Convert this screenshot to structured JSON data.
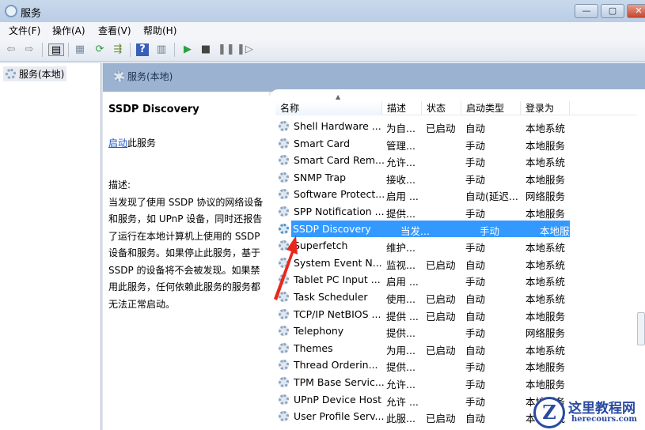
{
  "window": {
    "title": "服务",
    "minimize": "—",
    "maximize": "▢",
    "close": "✕"
  },
  "menu": [
    "文件(F)",
    "操作(A)",
    "查看(V)",
    "帮助(H)"
  ],
  "toolbar": {
    "icons": [
      "back-icon",
      "forward-icon",
      "console-tree-icon",
      "properties-icon",
      "refresh-icon",
      "export-icon",
      "help-icon",
      "view-icon",
      "start-icon",
      "stop-icon",
      "pause-icon",
      "resume-icon"
    ]
  },
  "tree": {
    "root": "服务(本地)"
  },
  "pane": {
    "title": "服务(本地)"
  },
  "detail": {
    "service_name": "SSDP Discovery",
    "start_link": "启动",
    "start_suffix": "此服务",
    "desc_label": "描述:",
    "description": "当发现了使用 SSDP 协议的网络设备和服务，如 UPnP 设备，同时还报告了运行在本地计算机上使用的 SSDP 设备和服务。如果停止此服务，基于 SSDP 的设备将不会被发现。如果禁用此服务，任何依赖此服务的服务都无法正常启动。"
  },
  "columns": [
    "名称",
    "描述",
    "状态",
    "启动类型",
    "登录为"
  ],
  "selected_color": "#3399ff",
  "rows": [
    [
      "Shell Hardware ...",
      "为自...",
      "已启动",
      "自动",
      "本地系统"
    ],
    [
      "Smart Card",
      "管理...",
      "",
      "手动",
      "本地服务"
    ],
    [
      "Smart Card Rem...",
      "允许...",
      "",
      "手动",
      "本地系统"
    ],
    [
      "SNMP Trap",
      "接收...",
      "",
      "手动",
      "本地服务"
    ],
    [
      "Software Protect...",
      "启用 ...",
      "",
      "自动(延迟...",
      "网络服务"
    ],
    [
      "SPP Notification ...",
      "提供...",
      "",
      "手动",
      "本地服务"
    ],
    [
      "SSDP Discovery",
      "当发...",
      "",
      "手动",
      "本地服务"
    ],
    [
      "Superfetch",
      "维护...",
      "",
      "手动",
      "本地系统"
    ],
    [
      "System Event N...",
      "监视...",
      "已启动",
      "自动",
      "本地系统"
    ],
    [
      "Tablet PC Input ...",
      "启用 ...",
      "",
      "手动",
      "本地系统"
    ],
    [
      "Task Scheduler",
      "使用...",
      "已启动",
      "自动",
      "本地系统"
    ],
    [
      "TCP/IP NetBIOS ...",
      "提供 ...",
      "已启动",
      "自动",
      "本地服务"
    ],
    [
      "Telephony",
      "提供...",
      "",
      "手动",
      "网络服务"
    ],
    [
      "Themes",
      "为用...",
      "已启动",
      "自动",
      "本地系统"
    ],
    [
      "Thread Orderin...",
      "提供...",
      "",
      "手动",
      "本地服务"
    ],
    [
      "TPM Base Servic...",
      "允许...",
      "",
      "手动",
      "本地服务"
    ],
    [
      "UPnP Device Host",
      "允许 ...",
      "",
      "手动",
      "本地服务"
    ],
    [
      "User Profile Serv...",
      "此服...",
      "已启动",
      "自动",
      "本地系统"
    ]
  ],
  "selected_index": 6,
  "watermark": {
    "cn": "这里教程网",
    "en": "herecours.com"
  }
}
